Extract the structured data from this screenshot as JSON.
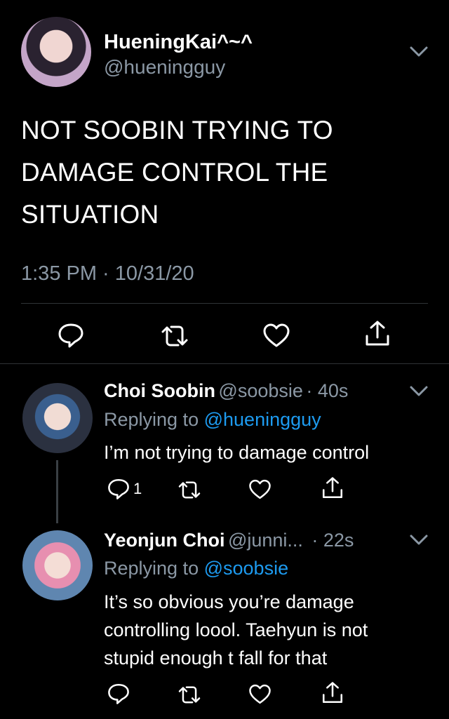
{
  "main_tweet": {
    "display_name": "HueningKai^~^",
    "handle": "@hueningguy",
    "text_lines": [
      "NOT SOOBIN TRYING TO",
      "DAMAGE CONTROL THE",
      "SITUATION"
    ],
    "timestamp": "1:35 PM · 10/31/20"
  },
  "replies": [
    {
      "display_name": "Choi Soobin",
      "handle": "@soobsie",
      "time": "· 40s",
      "replying_prefix": "Replying to",
      "replying_to": "@hueningguy",
      "text_lines": [
        "I’m not trying to damage control"
      ],
      "reply_count": "1"
    },
    {
      "display_name": "Yeonjun Choi",
      "handle": "@junni...",
      "time": "· 22s",
      "replying_prefix": "Replying to",
      "replying_to": "@soobsie",
      "text_lines": [
        "It’s so obvious you’re damage",
        "controlling loool. Taehyun is not",
        "stupid enough t fall for that"
      ]
    }
  ],
  "icons": {
    "reply": "reply-icon",
    "retweet": "retweet-icon",
    "like": "heart-icon",
    "share": "share-icon",
    "menu": "chevron-down-icon"
  },
  "colors": {
    "background": "#000000",
    "text": "#ffffff",
    "muted": "#8b98a5",
    "link": "#1d9bf0",
    "divider": "#2f3336"
  }
}
